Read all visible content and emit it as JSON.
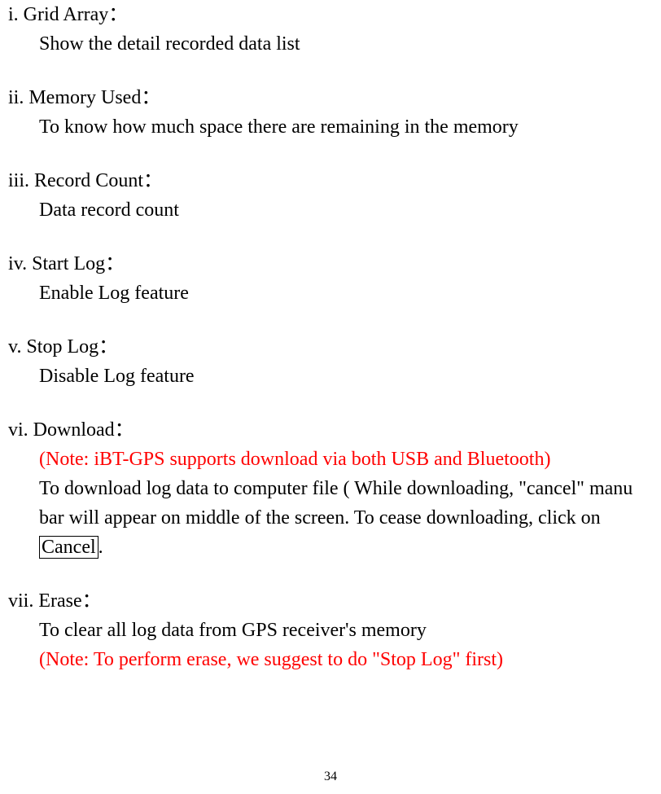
{
  "sections": {
    "i": {
      "title": "i. Grid Array：",
      "desc": "Show the detail recorded data list"
    },
    "ii": {
      "title": "ii. Memory Used：",
      "desc": "To know how much space there are remaining in the memory"
    },
    "iii": {
      "title": "iii. Record Count：",
      "desc": "Data record count"
    },
    "iv": {
      "title": "iv. Start Log：",
      "desc": "Enable Log feature"
    },
    "v": {
      "title": "v. Stop Log：",
      "desc": "Disable Log feature"
    },
    "vi": {
      "title": "vi. Download：",
      "note": "(Note: iBT-GPS supports download via both USB and Bluetooth)",
      "desc_pre": "To download log data to computer file ( While downloading, \"cancel\" manu bar will appear on middle of the screen. To cease downloading, click on ",
      "cancel_label": "Cancel",
      "desc_post": "."
    },
    "vii": {
      "title": "vii. Erase：",
      "desc": "To clear all log data from GPS receiver's memory",
      "note": "(Note: To perform erase, we suggest to do \"Stop Log\" first)"
    }
  },
  "page_number": "34"
}
